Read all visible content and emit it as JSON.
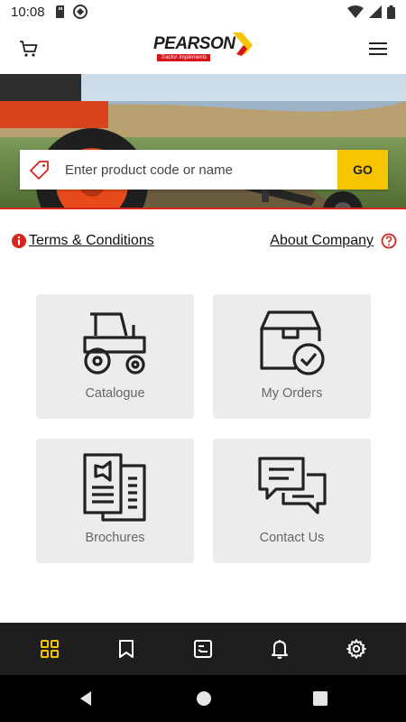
{
  "status_bar": {
    "time": "10:08"
  },
  "header": {
    "brand_name": "PEARSON",
    "brand_tagline": "Tractor Implements",
    "cart_icon": "cart-icon",
    "menu_icon": "hamburger-menu-icon"
  },
  "search": {
    "placeholder": "Enter product code or name",
    "button_label": "GO"
  },
  "links": {
    "terms_label": "Terms & Conditions",
    "about_label": "About Company"
  },
  "tiles": [
    {
      "label": "Catalogue",
      "icon": "tractor-icon"
    },
    {
      "label": "My Orders",
      "icon": "box-check-icon"
    },
    {
      "label": "Brochures",
      "icon": "brochure-icon"
    },
    {
      "label": "Contact Us",
      "icon": "chat-bubbles-icon"
    }
  ],
  "bottom_nav": [
    {
      "icon": "grid-icon",
      "active": true
    },
    {
      "icon": "bookmark-icon",
      "active": false
    },
    {
      "icon": "document-icon",
      "active": false
    },
    {
      "icon": "bell-icon",
      "active": false
    },
    {
      "icon": "gear-icon",
      "active": false
    }
  ],
  "colors": {
    "accent_yellow": "#f6c500",
    "brand_red": "#d9261c",
    "nav_background": "#1e1e1e",
    "tile_background": "#ececec"
  }
}
